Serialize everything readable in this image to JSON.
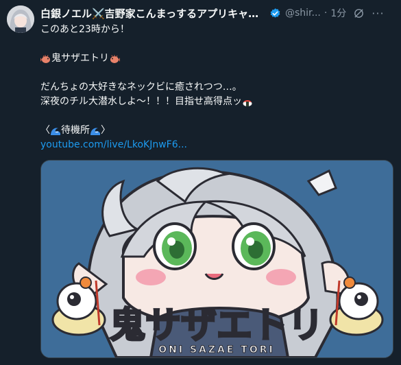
{
  "tweet": {
    "display_name": "白銀ノエル⚔️吉野家こんまっするアプリキャン...",
    "handle": "@shir...",
    "separator": "·",
    "time": "1分",
    "more": "···",
    "lines": {
      "l1": "このあと23時から！",
      "l2_text": "鬼サザエトリ",
      "l3": "だんちょの大好きなネックビに癒されつつ…。",
      "l4_text": "深夜のチル大潜水しよ〜！！！目指せ高得点ッ",
      "l5_open": "〈",
      "l5_text": "待機所",
      "l5_close": "〉"
    },
    "link": "youtube.com/live/LkoKJnwF6..."
  },
  "media": {
    "title": "鬼サザエトリ",
    "subtitle": "ONI SAZAE TORI"
  },
  "colors": {
    "background": "#15202b",
    "link": "#1d9bf0",
    "verified": "#1d9bf0",
    "secondary_text": "#8b98a5",
    "media_bg": "#3e6d99"
  },
  "icons": [
    "verified-badge-icon",
    "mute-icon",
    "fugu-emoji-icon",
    "sushi-emoji-icon",
    "wave-emoji-icon"
  ]
}
